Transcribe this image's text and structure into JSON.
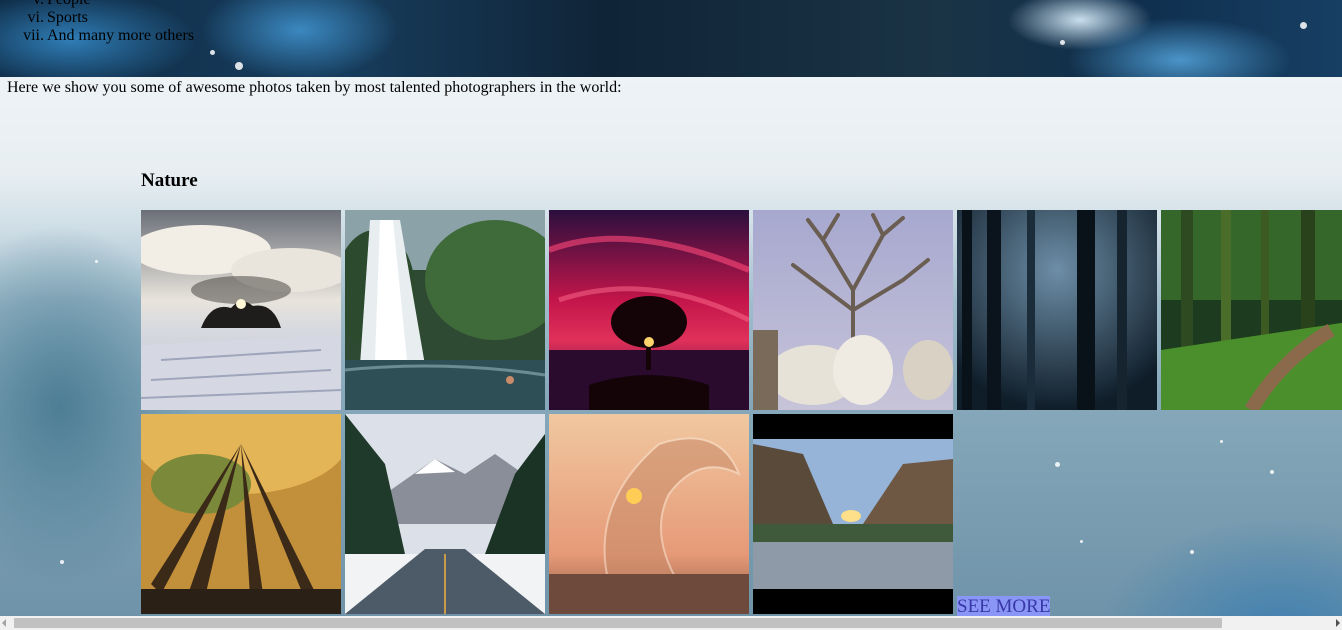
{
  "list": {
    "items": [
      {
        "num": "v.",
        "label": "People"
      },
      {
        "num": "vi.",
        "label": "Sports"
      },
      {
        "num": "vii.",
        "label": "And many more others"
      }
    ]
  },
  "intro_text": "Here we show you some of awesome photos taken by most talented photographers in the world:",
  "section_title": "Nature",
  "photos": [
    {
      "subject": "snowy field with tree island under dramatic clouds"
    },
    {
      "subject": "waterfall into pool with swimmer"
    },
    {
      "subject": "silhouetted tree against red sky"
    },
    {
      "subject": "cattle with branching antler-like tree"
    },
    {
      "subject": "dark misty forest"
    },
    {
      "subject": "green mossy forest path"
    },
    {
      "subject": "tall autumn trees looking up"
    },
    {
      "subject": "snowy mountain road with pines"
    },
    {
      "subject": "water splash at sunset"
    },
    {
      "subject": "canyon river at sunset"
    }
  ],
  "see_more_label": "SEE MORE",
  "colors": {
    "see_more_bg": "#8a96f5",
    "see_more_text": "#3838a8"
  }
}
